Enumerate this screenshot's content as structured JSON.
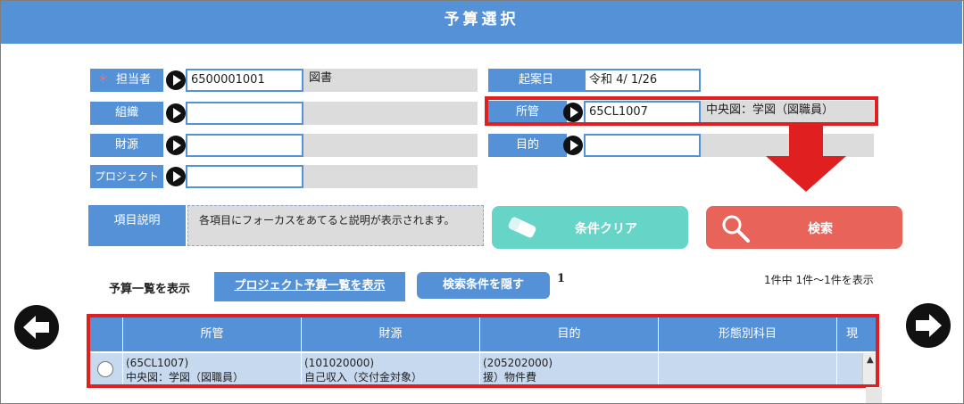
{
  "header": {
    "title": "予算選択"
  },
  "form": {
    "tanto": {
      "label": "担当者",
      "required_mark": "＊",
      "code": "6500001001",
      "name": "図書"
    },
    "soshiki": {
      "label": "組織",
      "code": "",
      "name": ""
    },
    "zaigen": {
      "label": "財源",
      "code": "",
      "name": ""
    },
    "project": {
      "label": "プロジェクト",
      "code": "",
      "name": ""
    },
    "kian_date": {
      "label": "起案日",
      "value": "令和 4/ 1/26"
    },
    "shokan": {
      "label": "所管",
      "code": "65CL1007",
      "name": "中央図：学図（図職員）"
    },
    "mokuteki": {
      "label": "目的",
      "code": "",
      "name": ""
    }
  },
  "description": {
    "label": "項目説明",
    "text": "各項目にフォーカスをあてると説明が表示されます。"
  },
  "buttons": {
    "clear": "条件クリア",
    "search": "検索"
  },
  "list_controls": {
    "title": "予算一覧を表示",
    "project_link": "プロジェクト予算一覧を表示",
    "hide_conditions": "検索条件を隠す",
    "page_number": "1",
    "count_text": "1件中 1件～1件を表示"
  },
  "table": {
    "columns": [
      "所管",
      "財源",
      "目的",
      "形態別科目",
      "現"
    ],
    "rows": [
      {
        "shokan": [
          "(65CL1007)",
          "中央図：学図（図職員）"
        ],
        "zaigen": [
          "(101020000)",
          "自己収入（交付金対象）"
        ],
        "mokuteki": [
          "(205202000)",
          "援）物件費"
        ],
        "keitai": ""
      }
    ]
  },
  "colors": {
    "accent": "#5591d6",
    "highlight": "#e02020",
    "clear_btn": "#66d4c6",
    "search_btn": "#e8645a"
  },
  "icons": [
    "arrow-right-circle-icon",
    "eraser-icon",
    "magnifier-icon",
    "arrow-left-icon",
    "arrow-right-icon",
    "arrow-down-icon"
  ]
}
